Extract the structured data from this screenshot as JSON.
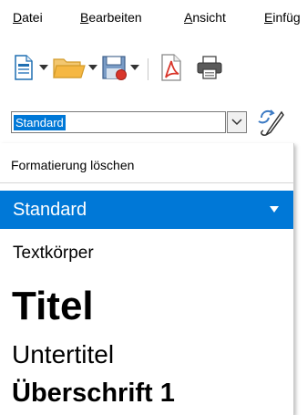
{
  "menu": {
    "items": [
      {
        "mnemonic": "D",
        "rest": "atei"
      },
      {
        "mnemonic": "B",
        "rest": "earbeiten"
      },
      {
        "mnemonic": "A",
        "rest": "nsicht"
      },
      {
        "mnemonic": "E",
        "rest": "infüg"
      }
    ]
  },
  "toolbar": {
    "icons": [
      "new-document-icon",
      "open-folder-icon",
      "save-icon",
      "export-pdf-icon",
      "print-icon"
    ]
  },
  "style_combo": {
    "value": "Standard",
    "update_icon": "update-style-icon"
  },
  "dropdown": {
    "clear_formatting": "Formatierung löschen",
    "selected": "Standard",
    "items": [
      "Textkörper",
      "Titel",
      "Untertitel",
      "Überschrift 1"
    ]
  },
  "colors": {
    "selection": "#0078d7",
    "folder": "#f5b742",
    "save": "#c0504d",
    "pdf_red": "#d9362b"
  }
}
